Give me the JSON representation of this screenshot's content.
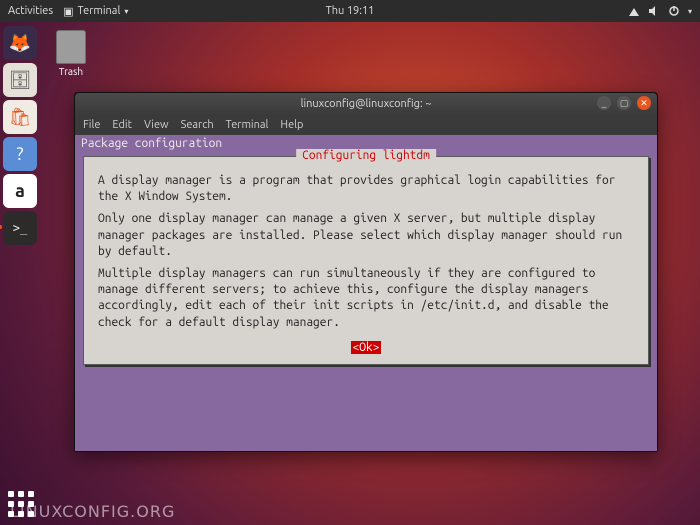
{
  "topbar": {
    "activities": "Activities",
    "app_name": "Terminal",
    "clock": "Thu 19:11"
  },
  "desktop": {
    "trash_label": "Trash"
  },
  "window": {
    "title": "linuxconfig@linuxconfig: ~",
    "menu": [
      "File",
      "Edit",
      "View",
      "Search",
      "Terminal",
      "Help"
    ]
  },
  "dialog": {
    "header": "Package configuration",
    "legend": "Configuring lightdm",
    "para1": "A display manager is a program that provides graphical login capabilities for the X Window System.",
    "para2": "Only one display manager can manage a given X server, but multiple display manager packages are installed. Please select which display manager should run by default.",
    "para3": "Multiple display managers can run simultaneously if they are configured to manage different servers; to achieve this, configure the display managers accordingly, edit each of their init scripts in /etc/init.d, and disable the check for a default display manager.",
    "ok_label": "<Ok>"
  },
  "watermark": "LINUXCONFIG.ORG"
}
